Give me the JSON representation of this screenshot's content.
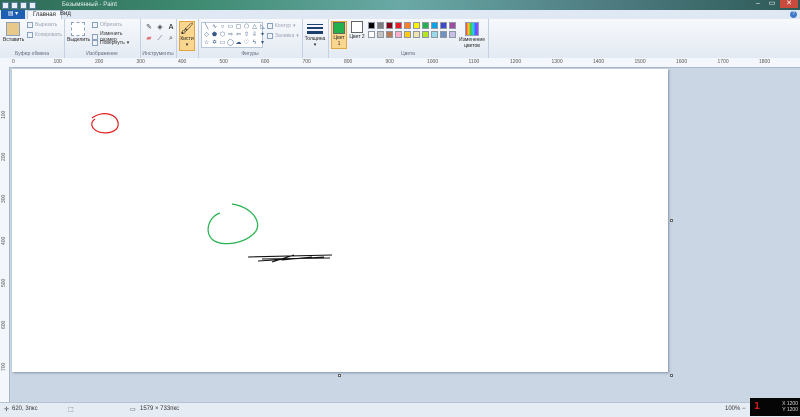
{
  "title": "Безымянный - Paint",
  "tabs": [
    "Главная",
    "Вид"
  ],
  "ribbon": {
    "clipboard": {
      "paste": "Вставить",
      "cut": "Вырезать",
      "copy": "Копировать",
      "label": "Буфер обмена"
    },
    "image": {
      "select": "Выделить",
      "crop": "Обрезать",
      "resize": "Изменить размер",
      "rotate": "Повернуть",
      "label": "Изображение"
    },
    "tools": {
      "label": "Инструменты"
    },
    "brushes": {
      "label": "Кисти"
    },
    "shapes": {
      "outline": "Контур",
      "fill": "Заливка",
      "label": "Фигуры"
    },
    "size": {
      "label": "Толщина"
    },
    "colors": {
      "color1": "Цвет 1",
      "color2": "Цвет 2",
      "edit": "Изменение цветов",
      "label": "Цвета"
    },
    "palette": [
      "#000000",
      "#7f7f7f",
      "#880015",
      "#ed1c24",
      "#ff7f27",
      "#fff200",
      "#22b14c",
      "#00a2e8",
      "#3f48cc",
      "#a349a4",
      "#ffffff",
      "#c3c3c3",
      "#b97a57",
      "#ffaec9",
      "#ffc90e",
      "#efe4b0",
      "#b5e61d",
      "#99d9ea",
      "#7092be",
      "#c8bfe7"
    ],
    "color1_value": "#22b14c",
    "color2_value": "#ffffff"
  },
  "ruler": {
    "top": [
      "0",
      "100",
      "200",
      "300",
      "400",
      "500",
      "600",
      "700",
      "800",
      "900",
      "1000",
      "1100",
      "1200",
      "1300",
      "1400",
      "1500",
      "1600",
      "1700",
      "1800"
    ],
    "left": [
      "100",
      "200",
      "300",
      "400",
      "500",
      "600",
      "700"
    ]
  },
  "status": {
    "cursor": "620, 3пкс",
    "canvas_size": "1579 × 733пкс",
    "zoom": "100%"
  },
  "tray": {
    "number": "1",
    "line1": "X 1200",
    "line2": "Y 1200"
  }
}
